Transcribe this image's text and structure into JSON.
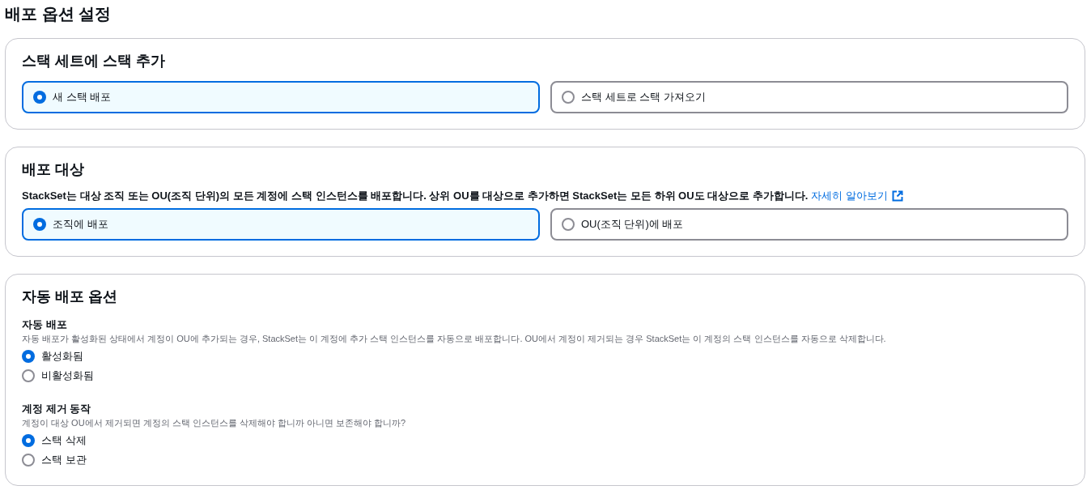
{
  "page": {
    "title": "배포 옵션 설정"
  },
  "sections": [
    {
      "kind": "tiles",
      "title": "스택 세트에 스택 추가",
      "options": [
        {
          "label": "새 스택 배포",
          "selected": true
        },
        {
          "label": "스택 세트로 스택 가져오기",
          "selected": false
        }
      ]
    },
    {
      "kind": "tiles",
      "title": "배포 대상",
      "description": "StackSet는 대상 조직 또는 OU(조직 단위)의 모든 계정에 스택 인스턴스를 배포합니다. 상위 OU를 대상으로 추가하면 StackSet는 모든 하위 OU도 대상으로 추가합니다.",
      "link": "자세히 알아보기",
      "options": [
        {
          "label": "조직에 배포",
          "selected": true
        },
        {
          "label": "OU(조직 단위)에 배포",
          "selected": false
        }
      ]
    },
    {
      "kind": "groups",
      "title": "자동 배포 옵션",
      "groups": [
        {
          "label": "자동 배포",
          "description": "자동 배포가 활성화된 상태에서 계정이 OU에 추가되는 경우, StackSet는 이 계정에 추가 스택 인스턴스를 자동으로 배포합니다. OU에서 계정이 제거되는 경우 StackSet는 이 계정의 스택 인스턴스를 자동으로 삭제합니다.",
          "options": [
            {
              "label": "활성화됨",
              "selected": true
            },
            {
              "label": "비활성화됨",
              "selected": false
            }
          ]
        },
        {
          "label": "계정 제거 동작",
          "description": "계정이 대상 OU에서 제거되면 계정의 스택 인스턴스를 삭제해야 합니까 아니면 보존해야 합니까?",
          "options": [
            {
              "label": "스택 삭제",
              "selected": true
            },
            {
              "label": "스택 보관",
              "selected": false
            }
          ]
        }
      ]
    }
  ]
}
